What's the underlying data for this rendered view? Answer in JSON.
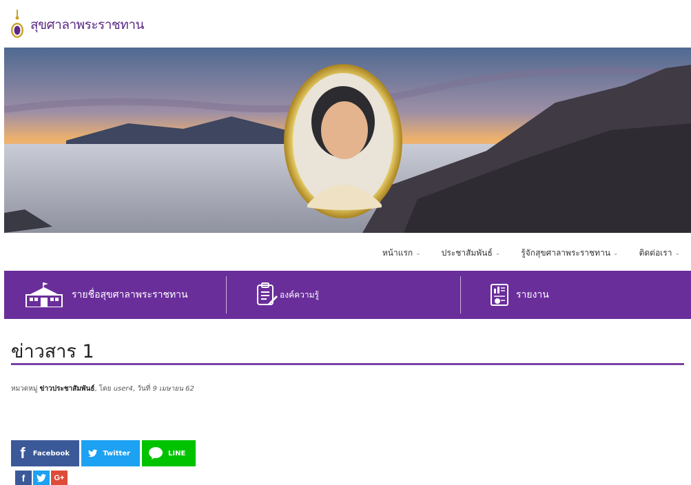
{
  "site": {
    "logo_text": "สุขศาลาพระราชทาน"
  },
  "nav": {
    "items": [
      {
        "label": "หน้าแรก"
      },
      {
        "label": "ประชาสัมพันธ์"
      },
      {
        "label": "รู้จักสุขศาลาพระราชทาน"
      },
      {
        "label": "ติดต่อเรา"
      }
    ]
  },
  "menu_bar": {
    "items": [
      {
        "label": "รายชื่อสุขศาลาพระราชทาน",
        "icon": "school-building-icon"
      },
      {
        "label": "องค์ความรู้",
        "icon": "notepad-pencil-icon"
      },
      {
        "label": "รายงาน",
        "icon": "report-document-icon"
      }
    ]
  },
  "article": {
    "title": "ข่าวสาร 1",
    "meta_prefix": "หมวดหมู่ ",
    "category": "ข่าวประชาสัมพันธ์",
    "meta_by": ", โดย ",
    "author": "user4",
    "meta_date_prefix": ", วันที่ ",
    "date": "9 เมษายน 62"
  },
  "share": {
    "facebook": "Facebook",
    "twitter": "Twitter",
    "line": "LINE",
    "small_gplus": "G+"
  },
  "colors": {
    "accent": "#6a2e9b",
    "facebook": "#3b5998",
    "twitter": "#1da1f2",
    "line": "#00c300"
  }
}
